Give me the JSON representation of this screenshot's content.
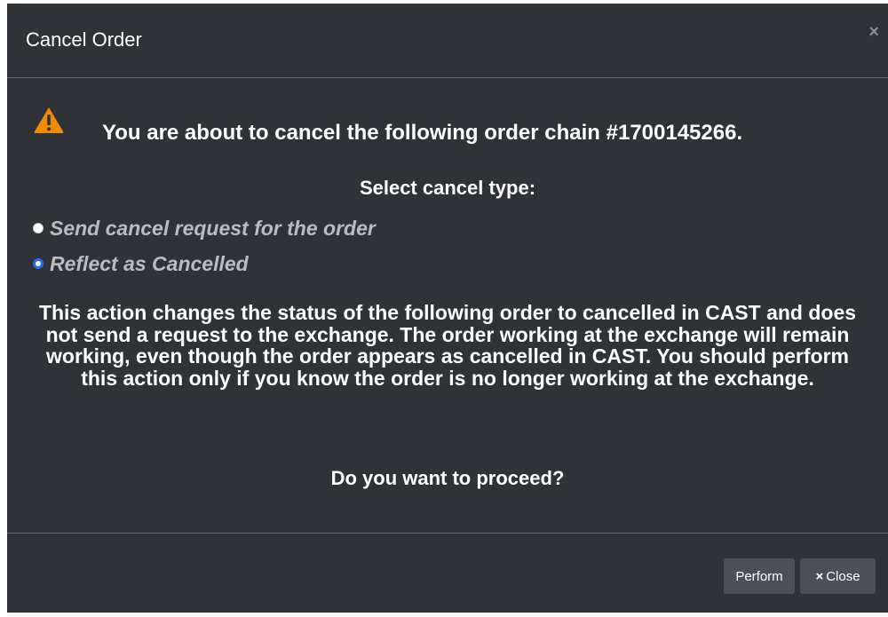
{
  "dialog": {
    "title": "Cancel Order",
    "close_symbol": "×"
  },
  "body": {
    "warning_icon": "warning-triangle-icon",
    "message": "You are about to cancel the following order chain #1700145266.",
    "select_label": "Select cancel type:",
    "options": [
      {
        "label": "Send cancel request for the order",
        "selected": false
      },
      {
        "label": "Reflect as Cancelled",
        "selected": true
      }
    ],
    "explanation": "This action changes the status of the following order to cancelled in CAST and does not send a request to the exchange. The order working at the exchange will remain working, even though the order appears as cancelled in CAST. You should perform this action only if you know the order is no longer working at the exchange.",
    "question": "Do you want to proceed?"
  },
  "footer": {
    "perform_label": "Perform",
    "close_icon": "×",
    "close_label": "Close"
  },
  "colors": {
    "modal_bg": "#2f3237",
    "accent_blue": "#1e6fe0",
    "warning_orange": "#f08c00",
    "button_bg": "#4b5057"
  }
}
